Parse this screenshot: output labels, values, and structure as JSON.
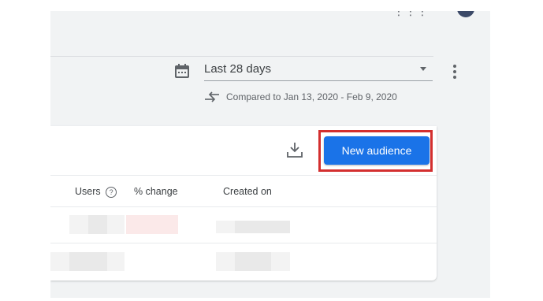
{
  "date_range": {
    "selected": "Last 28 days",
    "comparison": "Compared to Jan 13, 2020 - Feb 9, 2020"
  },
  "audiences_card": {
    "new_audience_label": "New audience",
    "columns": {
      "users": "Users",
      "percent_change": "% change",
      "created_on": "Created on"
    }
  },
  "colors": {
    "primary_button": "#1a73e8",
    "highlight_outline": "#d32f2f"
  },
  "icons": [
    "apps-icon",
    "account-icon",
    "calendar-icon",
    "caret-down-icon",
    "more-vert-icon",
    "compare-arrows-icon",
    "download-icon",
    "help-icon"
  ]
}
